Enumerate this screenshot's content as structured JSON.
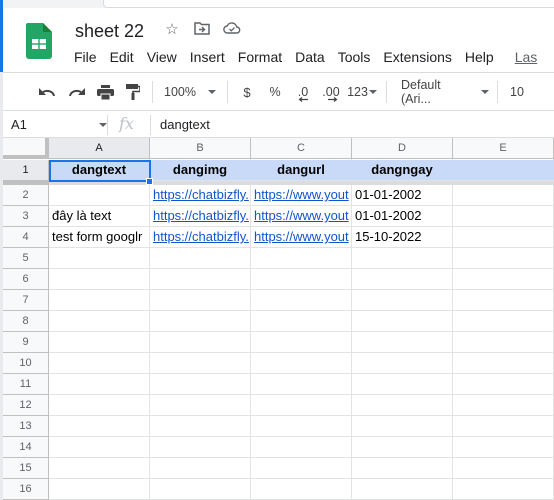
{
  "document": {
    "title": "sheet 22",
    "icons": [
      "star-icon",
      "move-to-folder-icon",
      "cloud-saved-icon"
    ]
  },
  "menu": {
    "items": [
      "File",
      "Edit",
      "View",
      "Insert",
      "Format",
      "Data",
      "Tools",
      "Extensions",
      "Help"
    ],
    "last_edit": "Las"
  },
  "toolbar": {
    "zoom": "100%",
    "currency": "$",
    "percent": "%",
    "decrease_decimal": ".0",
    "increase_decimal": ".00",
    "more_formats": "123",
    "font": "Default (Ari...",
    "font_size": "10"
  },
  "formula_bar": {
    "name_box": "A1",
    "fx": "fx",
    "value": "dangtext"
  },
  "grid": {
    "columns": [
      "A",
      "B",
      "C",
      "D",
      "E"
    ],
    "selected_cell": "A1",
    "rows": [
      {
        "num": "1",
        "cells": [
          "dangtext",
          "dangimg",
          "dangurl",
          "dangngay",
          ""
        ]
      },
      {
        "num": "2",
        "cells": [
          "",
          "https://chatbizfly.",
          "https://www.yout",
          "01-01-2002",
          ""
        ]
      },
      {
        "num": "3",
        "cells": [
          "đây là text",
          "https://chatbizfly.",
          "https://www.yout",
          "01-01-2002",
          ""
        ]
      },
      {
        "num": "4",
        "cells": [
          "test form googlr",
          "https://chatbizfly.",
          "https://www.yout",
          "15-10-2022",
          ""
        ]
      },
      {
        "num": "5",
        "cells": [
          "",
          "",
          "",
          "",
          ""
        ]
      },
      {
        "num": "6",
        "cells": [
          "",
          "",
          "",
          "",
          ""
        ]
      },
      {
        "num": "7",
        "cells": [
          "",
          "",
          "",
          "",
          ""
        ]
      },
      {
        "num": "8",
        "cells": [
          "",
          "",
          "",
          "",
          ""
        ]
      },
      {
        "num": "9",
        "cells": [
          "",
          "",
          "",
          "",
          ""
        ]
      },
      {
        "num": "10",
        "cells": [
          "",
          "",
          "",
          "",
          ""
        ]
      },
      {
        "num": "11",
        "cells": [
          "",
          "",
          "",
          "",
          ""
        ]
      },
      {
        "num": "12",
        "cells": [
          "",
          "",
          "",
          "",
          ""
        ]
      },
      {
        "num": "13",
        "cells": [
          "",
          "",
          "",
          "",
          ""
        ]
      },
      {
        "num": "14",
        "cells": [
          "",
          "",
          "",
          "",
          ""
        ]
      },
      {
        "num": "15",
        "cells": [
          "",
          "",
          "",
          "",
          ""
        ]
      },
      {
        "num": "16",
        "cells": [
          "",
          "",
          "",
          "",
          ""
        ]
      }
    ]
  },
  "colors": {
    "header_row_fill": "#c9daf8",
    "link": "#1155cc",
    "selection": "#1a73e8",
    "sheets_green": "#23a566"
  }
}
